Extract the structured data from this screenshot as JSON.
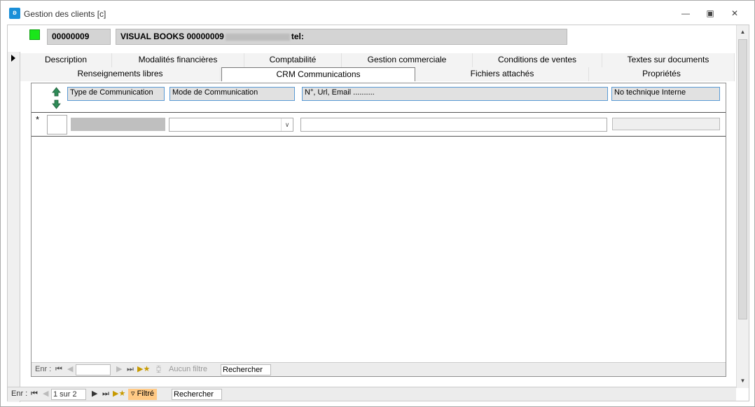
{
  "window": {
    "title": "Gestion des clients [c]",
    "icon": "app-icon",
    "controls": [
      "minimize",
      "restore",
      "close"
    ]
  },
  "record": {
    "id": "00000009",
    "name_prefix": "VISUAL BOOKS 00000009",
    "name_suffix": "tel:",
    "status_color": "#19e619"
  },
  "tabs": {
    "row1": [
      "Description",
      "Modalités financières",
      "Comptabilité",
      "Gestion commerciale",
      "Conditions de ventes",
      "Textes sur documents"
    ],
    "row2": [
      "Renseignements libres",
      "CRM Communications",
      "Fichiers attachés",
      "Propriétés"
    ],
    "active": "CRM Communications"
  },
  "grid": {
    "columns": [
      "Type de Communication",
      "Mode de Communication",
      "N°, Url, Email ..........",
      "No technique Interne"
    ],
    "new_row_marker": "*"
  },
  "subform_nav": {
    "label": "Enr :",
    "record_value": "",
    "filter_label": "Aucun filtre",
    "search_label": "Rechercher"
  },
  "form_nav": {
    "label": "Enr :",
    "record_value": "1 sur 2",
    "filter_label": "Filtré",
    "search_label": "Rechercher"
  }
}
